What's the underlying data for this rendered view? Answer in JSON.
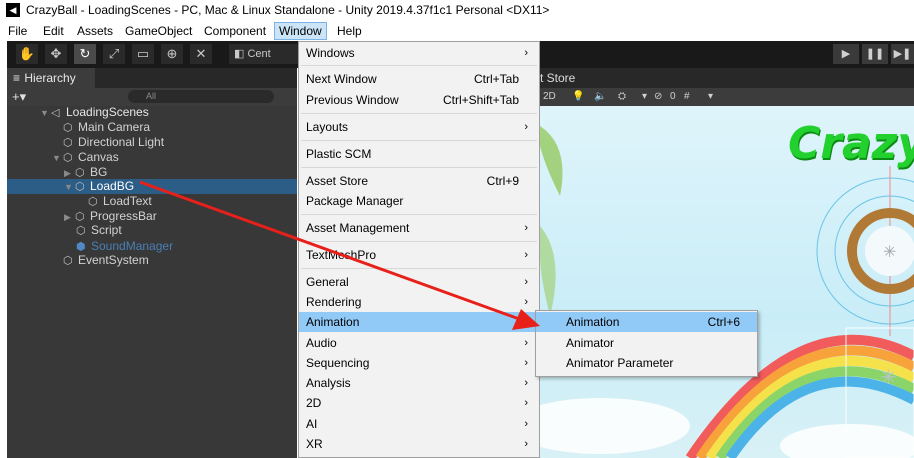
{
  "window": {
    "title": "CrazyBall - LoadingScenes - PC, Mac & Linux Standalone - Unity 2019.4.37f1c1 Personal <DX11>",
    "logo_icon": "unity-logo-icon"
  },
  "menubar": {
    "items": [
      "File",
      "Edit",
      "Assets",
      "GameObject",
      "Component",
      "Window",
      "Help"
    ],
    "active": "Window"
  },
  "toolbar": {
    "tools": [
      "hand-tool-icon",
      "move-tool-icon",
      "rotate-tool-icon",
      "scale-tool-icon",
      "rect-tool-icon",
      "transform-tool-icon",
      "custom-tool-icon"
    ],
    "pivot_label": "Cent",
    "play_controls": [
      "play-icon",
      "pause-icon",
      "step-icon"
    ]
  },
  "hierarchy": {
    "tab_label": "Hierarchy",
    "add_label": "+▾",
    "search_placeholder": "All",
    "scene_name": "LoadingScenes",
    "items": [
      {
        "label": "Main Camera"
      },
      {
        "label": "Directional Light"
      },
      {
        "label": "Canvas"
      },
      {
        "label": "BG"
      },
      {
        "label": "LoadBG"
      },
      {
        "label": "LoadText"
      },
      {
        "label": "ProgressBar"
      },
      {
        "label": "Script"
      },
      {
        "label": "SoundManager"
      },
      {
        "label": "EventSystem"
      }
    ],
    "selected": "LoadBG"
  },
  "scene": {
    "tab_fragment": "t Store",
    "mode_2d": "2D",
    "gizmo_count": "0",
    "banner_text": "Crazy"
  },
  "window_menu": {
    "items": [
      {
        "label": "Windows",
        "shortcut": "",
        "submenu": true
      },
      {
        "label": "Next Window",
        "shortcut": "Ctrl+Tab",
        "submenu": false
      },
      {
        "label": "Previous Window",
        "shortcut": "Ctrl+Shift+Tab",
        "submenu": false
      },
      {
        "label": "Layouts",
        "shortcut": "",
        "submenu": true
      },
      {
        "label": "Plastic SCM",
        "shortcut": "",
        "submenu": false
      },
      {
        "label": "Asset Store",
        "shortcut": "Ctrl+9",
        "submenu": false
      },
      {
        "label": "Package Manager",
        "shortcut": "",
        "submenu": false
      },
      {
        "label": "Asset Management",
        "shortcut": "",
        "submenu": true
      },
      {
        "label": "TextMeshPro",
        "shortcut": "",
        "submenu": true
      },
      {
        "label": "General",
        "shortcut": "",
        "submenu": true
      },
      {
        "label": "Rendering",
        "shortcut": "",
        "submenu": true
      },
      {
        "label": "Animation",
        "shortcut": "",
        "submenu": true
      },
      {
        "label": "Audio",
        "shortcut": "",
        "submenu": true
      },
      {
        "label": "Sequencing",
        "shortcut": "",
        "submenu": true
      },
      {
        "label": "Analysis",
        "shortcut": "",
        "submenu": true
      },
      {
        "label": "2D",
        "shortcut": "",
        "submenu": true
      },
      {
        "label": "AI",
        "shortcut": "",
        "submenu": true
      },
      {
        "label": "XR",
        "shortcut": "",
        "submenu": true
      }
    ],
    "highlighted": "Animation"
  },
  "animation_submenu": {
    "items": [
      {
        "label": "Animation",
        "shortcut": "Ctrl+6"
      },
      {
        "label": "Animator",
        "shortcut": ""
      },
      {
        "label": "Animator Parameter",
        "shortcut": ""
      }
    ],
    "highlighted": "Animation"
  },
  "annotation": {
    "color": "#e8201a"
  },
  "colors": {
    "accent": "#2c5d87",
    "menu_highlight": "#91c9f7",
    "banner_text": "#22d12d"
  }
}
